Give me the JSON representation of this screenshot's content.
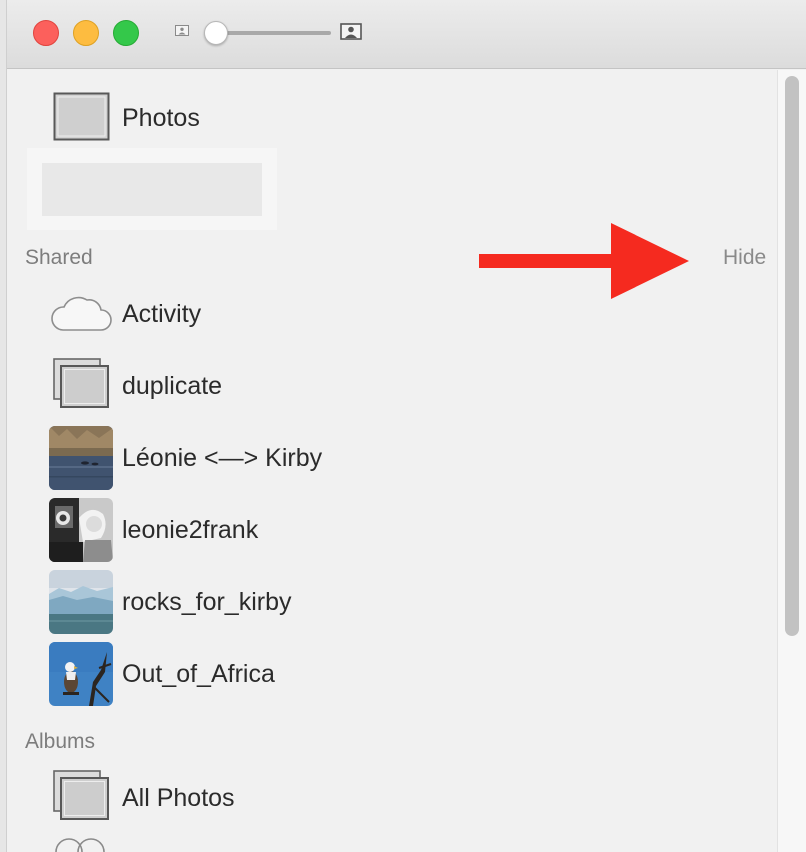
{
  "toolbar": {
    "thumbnail_size_small_icon": "photo-small-icon",
    "thumbnail_size_slider_value": 0,
    "thumbnail_size_large_icon": "photo-large-icon"
  },
  "sidebar": {
    "library": {
      "label": "Photos",
      "icon": "photo-icon"
    },
    "shared": {
      "header": "Shared",
      "hide_label": "Hide",
      "items": [
        {
          "label": "Activity",
          "icon": "cloud-icon"
        },
        {
          "label": "duplicate",
          "icon": "stacked-photos-icon"
        },
        {
          "label": "Léonie <—> Kirby",
          "icon": "lake-thumbnail"
        },
        {
          "label": "leonie2frank",
          "icon": "bw-photo-thumbnail"
        },
        {
          "label": "rocks_for_kirby",
          "icon": "glacier-thumbnail"
        },
        {
          "label": "Out_of_Africa",
          "icon": "eagle-thumbnail"
        }
      ]
    },
    "albums": {
      "header": "Albums",
      "items": [
        {
          "label": "All Photos",
          "icon": "stacked-photos-icon"
        }
      ]
    }
  },
  "annotation": {
    "arrow_color": "#f52a1f"
  },
  "colors": {
    "window_bg": "#f1f1f1",
    "label_text": "#2b2b2b",
    "section_text": "#7d7d7d"
  }
}
